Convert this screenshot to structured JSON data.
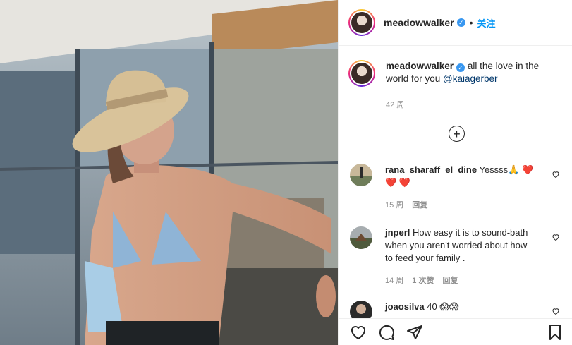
{
  "header": {
    "username": "meadowwalker",
    "separator": "•",
    "follow_label": "关注"
  },
  "caption": {
    "username": "meadowwalker",
    "text": "all the love in the world for you ",
    "mention": "@kaiagerber",
    "age": "42 周"
  },
  "comments": [
    {
      "username": "rana_sharaff_el_dine",
      "text": "Yessss🙏 ❤️",
      "text_line2": "❤️ ❤️",
      "time": "15 周",
      "reply_label": "回复"
    },
    {
      "username": "jnperl",
      "text": "How easy it is to sound-bath when you aren't worried about how to feed your family .",
      "time": "14 周",
      "likes": "1 次赞",
      "reply_label": "回复"
    },
    {
      "username": "joaosilva",
      "text": "40 😱😱"
    }
  ],
  "colors": {
    "link_blue": "#0095f6",
    "verified_blue": "#3897f0",
    "heart_red": "#ed4956",
    "meta_gray": "#8e8e8e"
  },
  "icons": [
    "verified-badge-icon",
    "load-more-icon",
    "heart-icon",
    "comment-icon",
    "share-icon",
    "bookmark-icon"
  ]
}
